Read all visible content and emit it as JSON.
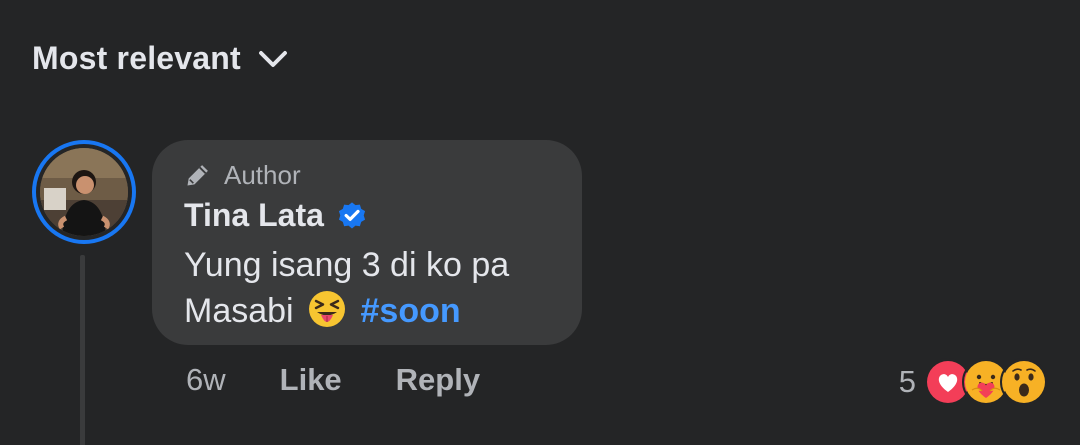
{
  "sort": {
    "label": "Most relevant",
    "icon": "chevron-down-icon"
  },
  "comment": {
    "author_tag": "Author",
    "author_name": "Tina Lata",
    "verified": true,
    "text_line1": "Yung isang 3 di ko pa",
    "text_line2_prefix": "Masabi",
    "emoji": "squinting-face-with-tongue",
    "hashtag": "#soon",
    "time": "6w",
    "like_label": "Like",
    "reply_label": "Reply",
    "reaction_count": "5",
    "reactions": [
      "love",
      "care",
      "wow"
    ]
  },
  "colors": {
    "background": "#242526",
    "bubble": "#3a3b3c",
    "accent": "#1877f2",
    "hashtag": "#4599ff",
    "secondary_text": "#b0b3b8",
    "primary_text": "#e4e6eb"
  }
}
